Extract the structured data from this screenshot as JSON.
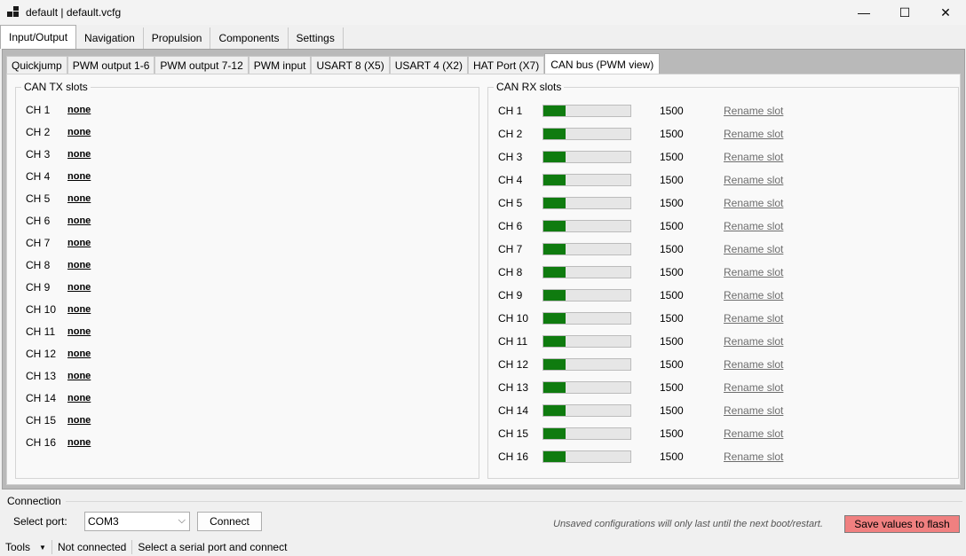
{
  "window": {
    "title": "default | default.vcfg",
    "minimize": "—",
    "maximize": "☐",
    "close": "✕"
  },
  "main_tabs": [
    {
      "label": "Input/Output",
      "active": true
    },
    {
      "label": "Navigation"
    },
    {
      "label": "Propulsion"
    },
    {
      "label": "Components"
    },
    {
      "label": "Settings"
    }
  ],
  "sub_tabs": [
    {
      "label": "Quickjump"
    },
    {
      "label": "PWM output 1-6"
    },
    {
      "label": "PWM output 7-12"
    },
    {
      "label": "PWM input"
    },
    {
      "label": "USART 8 (X5)"
    },
    {
      "label": "USART 4 (X2)"
    },
    {
      "label": "HAT Port (X7)"
    },
    {
      "label": "CAN bus (PWM view)",
      "active": true
    }
  ],
  "tx": {
    "title": "CAN TX slots",
    "slots": [
      {
        "ch": "CH 1",
        "value": "none"
      },
      {
        "ch": "CH 2",
        "value": "none"
      },
      {
        "ch": "CH 3",
        "value": "none"
      },
      {
        "ch": "CH 4",
        "value": "none"
      },
      {
        "ch": "CH 5",
        "value": "none"
      },
      {
        "ch": "CH 6",
        "value": "none"
      },
      {
        "ch": "CH 7",
        "value": "none"
      },
      {
        "ch": "CH 8",
        "value": "none"
      },
      {
        "ch": "CH 9",
        "value": "none"
      },
      {
        "ch": "CH 10",
        "value": "none"
      },
      {
        "ch": "CH 11",
        "value": "none"
      },
      {
        "ch": "CH 12",
        "value": "none"
      },
      {
        "ch": "CH 13",
        "value": "none"
      },
      {
        "ch": "CH 14",
        "value": "none"
      },
      {
        "ch": "CH 15",
        "value": "none"
      },
      {
        "ch": "CH 16",
        "value": "none"
      }
    ]
  },
  "rx": {
    "title": "CAN RX slots",
    "rename_label": "Rename slot",
    "bar_color": "#0f7b0f",
    "slots": [
      {
        "ch": "CH 1",
        "value": "1500",
        "level": 0.25
      },
      {
        "ch": "CH 2",
        "value": "1500",
        "level": 0.25
      },
      {
        "ch": "CH 3",
        "value": "1500",
        "level": 0.25
      },
      {
        "ch": "CH 4",
        "value": "1500",
        "level": 0.25
      },
      {
        "ch": "CH 5",
        "value": "1500",
        "level": 0.25
      },
      {
        "ch": "CH 6",
        "value": "1500",
        "level": 0.25
      },
      {
        "ch": "CH 7",
        "value": "1500",
        "level": 0.25
      },
      {
        "ch": "CH 8",
        "value": "1500",
        "level": 0.25
      },
      {
        "ch": "CH 9",
        "value": "1500",
        "level": 0.25
      },
      {
        "ch": "CH 10",
        "value": "1500",
        "level": 0.25
      },
      {
        "ch": "CH 11",
        "value": "1500",
        "level": 0.25
      },
      {
        "ch": "CH 12",
        "value": "1500",
        "level": 0.25
      },
      {
        "ch": "CH 13",
        "value": "1500",
        "level": 0.25
      },
      {
        "ch": "CH 14",
        "value": "1500",
        "level": 0.25
      },
      {
        "ch": "CH 15",
        "value": "1500",
        "level": 0.25
      },
      {
        "ch": "CH 16",
        "value": "1500",
        "level": 0.25
      }
    ]
  },
  "connection": {
    "title": "Connection",
    "port_label": "Select port:",
    "port_value": "COM3",
    "connect_label": "Connect",
    "note": "Unsaved configurations will only last until the next boot/restart.",
    "save_label": "Save values to flash",
    "save_color": "#f08080"
  },
  "status": {
    "tools": "Tools",
    "connection_state": "Not connected",
    "hint": "Select a serial port and connect"
  }
}
